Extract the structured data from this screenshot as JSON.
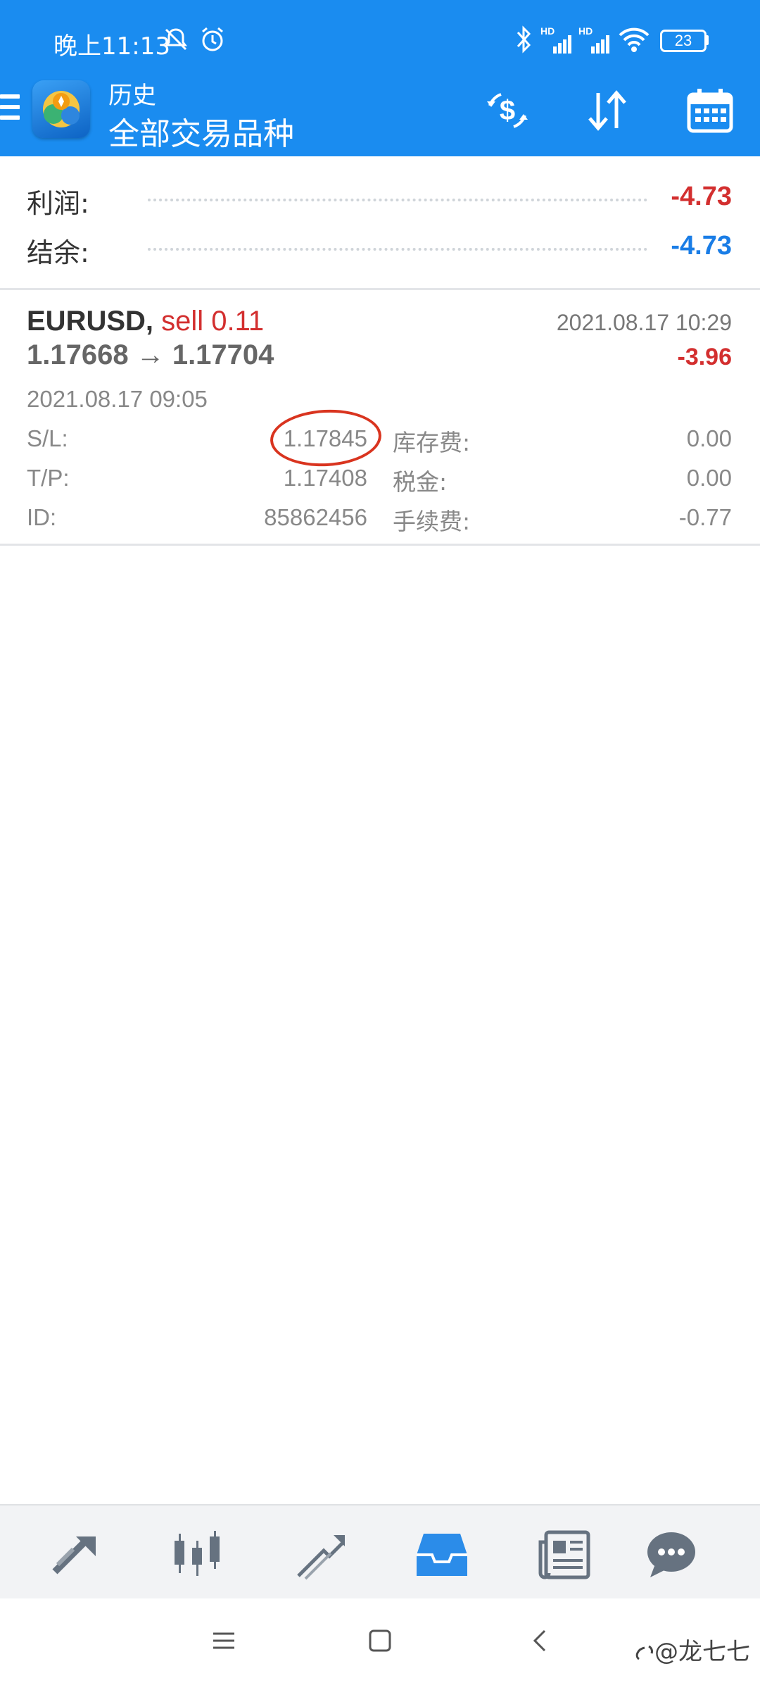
{
  "status_bar": {
    "time": "晚上11:13",
    "battery": "23",
    "network_labels": [
      "HD",
      "HD"
    ]
  },
  "app_bar": {
    "title": "历史",
    "subtitle": "全部交易品种",
    "icons": [
      "menu-icon",
      "app-logo",
      "currency-exchange-icon",
      "sort-icon",
      "calendar-icon"
    ]
  },
  "summary": {
    "profit_label": "利润:",
    "profit_value": "-4.73",
    "balance_label": "结余:",
    "balance_value": "-4.73"
  },
  "trade": {
    "symbol": "EURUSD,",
    "side": "sell 0.11",
    "prices": "1.17668 → 1.17704",
    "close_time": "2021.08.17 10:29",
    "profit": "-3.96",
    "open_time": "2021.08.17 09:05",
    "sl_label": "S/L:",
    "sl_value": "1.17845",
    "tp_label": "T/P:",
    "tp_value": "1.17408",
    "id_label": "ID:",
    "id_value": "85862456",
    "swap_label": "库存费:",
    "swap_value": "0.00",
    "tax_label": "税金:",
    "tax_value": "0.00",
    "commission_label": "手续费:",
    "commission_value": "-0.77"
  },
  "tabs": [
    "quotes-icon",
    "chart-icon",
    "trade-icon",
    "history-icon",
    "news-icon",
    "chat-icon"
  ],
  "active_tab": "history-icon",
  "watermark": "@龙七七",
  "colors": {
    "primary": "#1a8cf0",
    "negative": "#d32f2f",
    "balance": "#1a7de6",
    "annotation": "#d9341f"
  }
}
